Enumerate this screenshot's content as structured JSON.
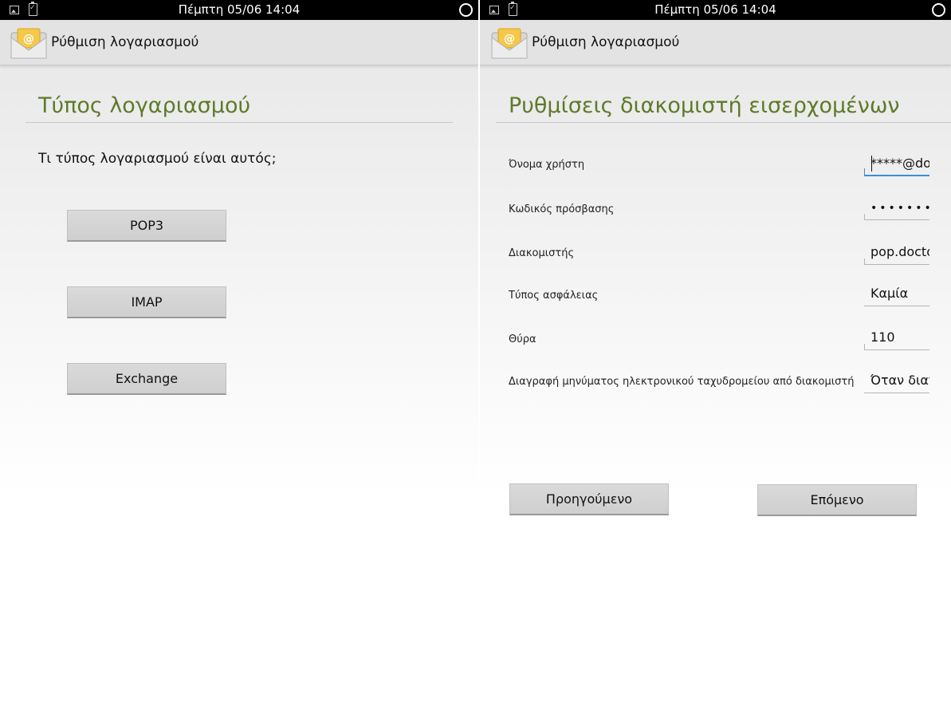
{
  "status_bar": {
    "time": "Πέμπτη 05/06 14:04"
  },
  "app": {
    "title": "Ρύθμιση λογαριασμού"
  },
  "left_screen": {
    "heading": "Τύπος λογαριασμού",
    "question": "Τι τύπος λογαριασμού είναι αυτός;",
    "buttons": {
      "pop3": "POP3",
      "imap": "IMAP",
      "exchange": "Exchange"
    }
  },
  "right_screen": {
    "heading": "Ρυθμίσεις διακομιστή εισερχομένων",
    "fields": {
      "username": {
        "label": "Όνομα χρήστη",
        "value": "*****@doc"
      },
      "password": {
        "label": "Κωδικός πρόσβασης",
        "value": "••••••••"
      },
      "server": {
        "label": "Διακομιστής",
        "value": "pop.docto"
      },
      "security": {
        "label": "Τύπος ασφάλειας",
        "value": "Καμία"
      },
      "port": {
        "label": "Θύρα",
        "value": "110"
      },
      "delete": {
        "label": "Διαγραφή μηνύματος ηλεκτρονικού ταχυδρομείου από διακομιστή",
        "value": "Όταν διαγρ"
      }
    },
    "buttons": {
      "previous": "Προηγούμενο",
      "next": "Επόμενο"
    }
  }
}
